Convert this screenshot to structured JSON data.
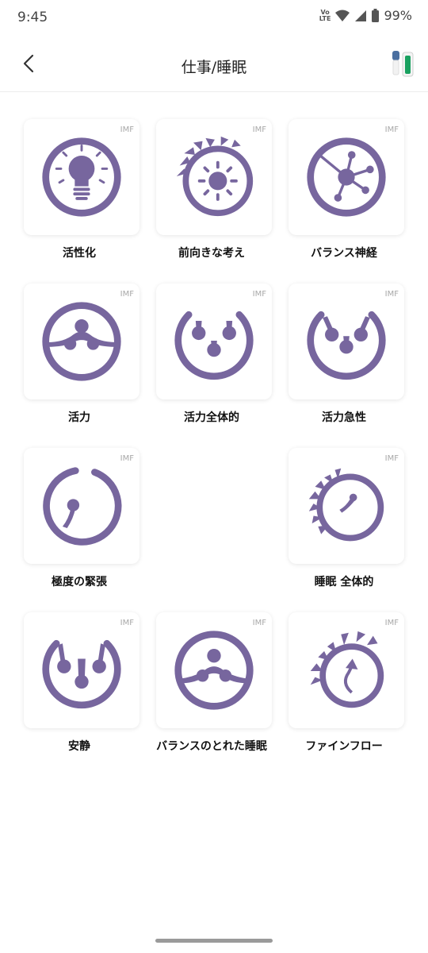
{
  "status": {
    "time": "9:45",
    "volte_top": "Vo",
    "volte_bottom": "LTE",
    "battery": "99%"
  },
  "header": {
    "title": "仕事/睡眠"
  },
  "tag": "IMF",
  "colors": {
    "accent": "#77669e"
  },
  "programs": [
    {
      "label": "活性化",
      "icon": "lightbulb-icon"
    },
    {
      "label": "前向きな考え",
      "icon": "sun-icon"
    },
    {
      "label": "バランス神経",
      "icon": "neuron-icon"
    },
    {
      "label": "活力",
      "icon": "vitality-icon"
    },
    {
      "label": "活力全体的",
      "icon": "vitality-overall-icon"
    },
    {
      "label": "活力急性",
      "icon": "vitality-acute-icon"
    },
    {
      "label": "極度の緊張",
      "icon": "extreme-tension-icon"
    },
    {
      "label": "睡眠 全体的",
      "icon": "sleep-overall-icon"
    },
    {
      "label": "安静",
      "icon": "rest-icon"
    },
    {
      "label": "バランスのとれた睡眠",
      "icon": "balanced-sleep-icon"
    },
    {
      "label": "ファインフロー",
      "icon": "fine-flow-icon"
    }
  ]
}
